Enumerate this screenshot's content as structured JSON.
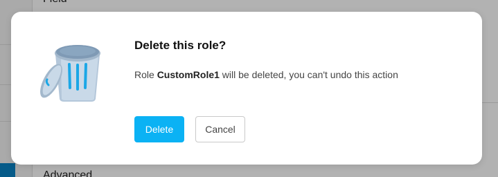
{
  "background": {
    "section_top_label": "Field",
    "section_bottom_label": "Advanced"
  },
  "dialog": {
    "icon": "trash-can-icon",
    "title": "Delete this role?",
    "message_prefix": "Role ",
    "role_name": "CustomRole1",
    "message_suffix": " will be deleted, you can't undo this action",
    "delete_label": "Delete",
    "cancel_label": "Cancel"
  },
  "colors": {
    "primary_button": "#0bb2f4",
    "overlay": "rgba(0,0,0,0.3)",
    "accent_blue": "#0a83c4"
  }
}
